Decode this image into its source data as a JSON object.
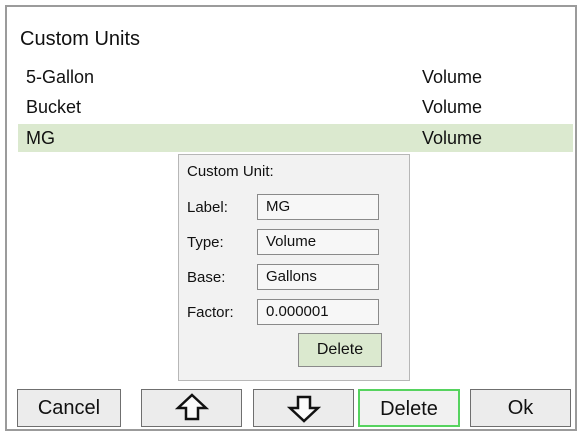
{
  "dialog": {
    "title": "Custom Units"
  },
  "units": [
    {
      "name": "5-Gallon",
      "type": "Volume"
    },
    {
      "name": "Bucket",
      "type": "Volume"
    },
    {
      "name": "MG",
      "type": "Volume"
    }
  ],
  "selected_index": 2,
  "detail": {
    "heading": "Custom Unit:",
    "fields": [
      {
        "label": "Label:",
        "value": "MG"
      },
      {
        "label": "Type:",
        "value": "Volume"
      },
      {
        "label": "Base:",
        "value": "Gallons"
      },
      {
        "label": "Factor:",
        "value": "0.000001"
      }
    ],
    "delete_label": "Delete"
  },
  "toolbar": {
    "cancel_label": "Cancel",
    "up_icon": "arrow-up-icon",
    "down_icon": "arrow-down-icon",
    "delete_label": "Delete",
    "ok_label": "Ok"
  },
  "colors": {
    "selected_row": "#dbe9cf",
    "active_button_border": "#56d35f"
  }
}
